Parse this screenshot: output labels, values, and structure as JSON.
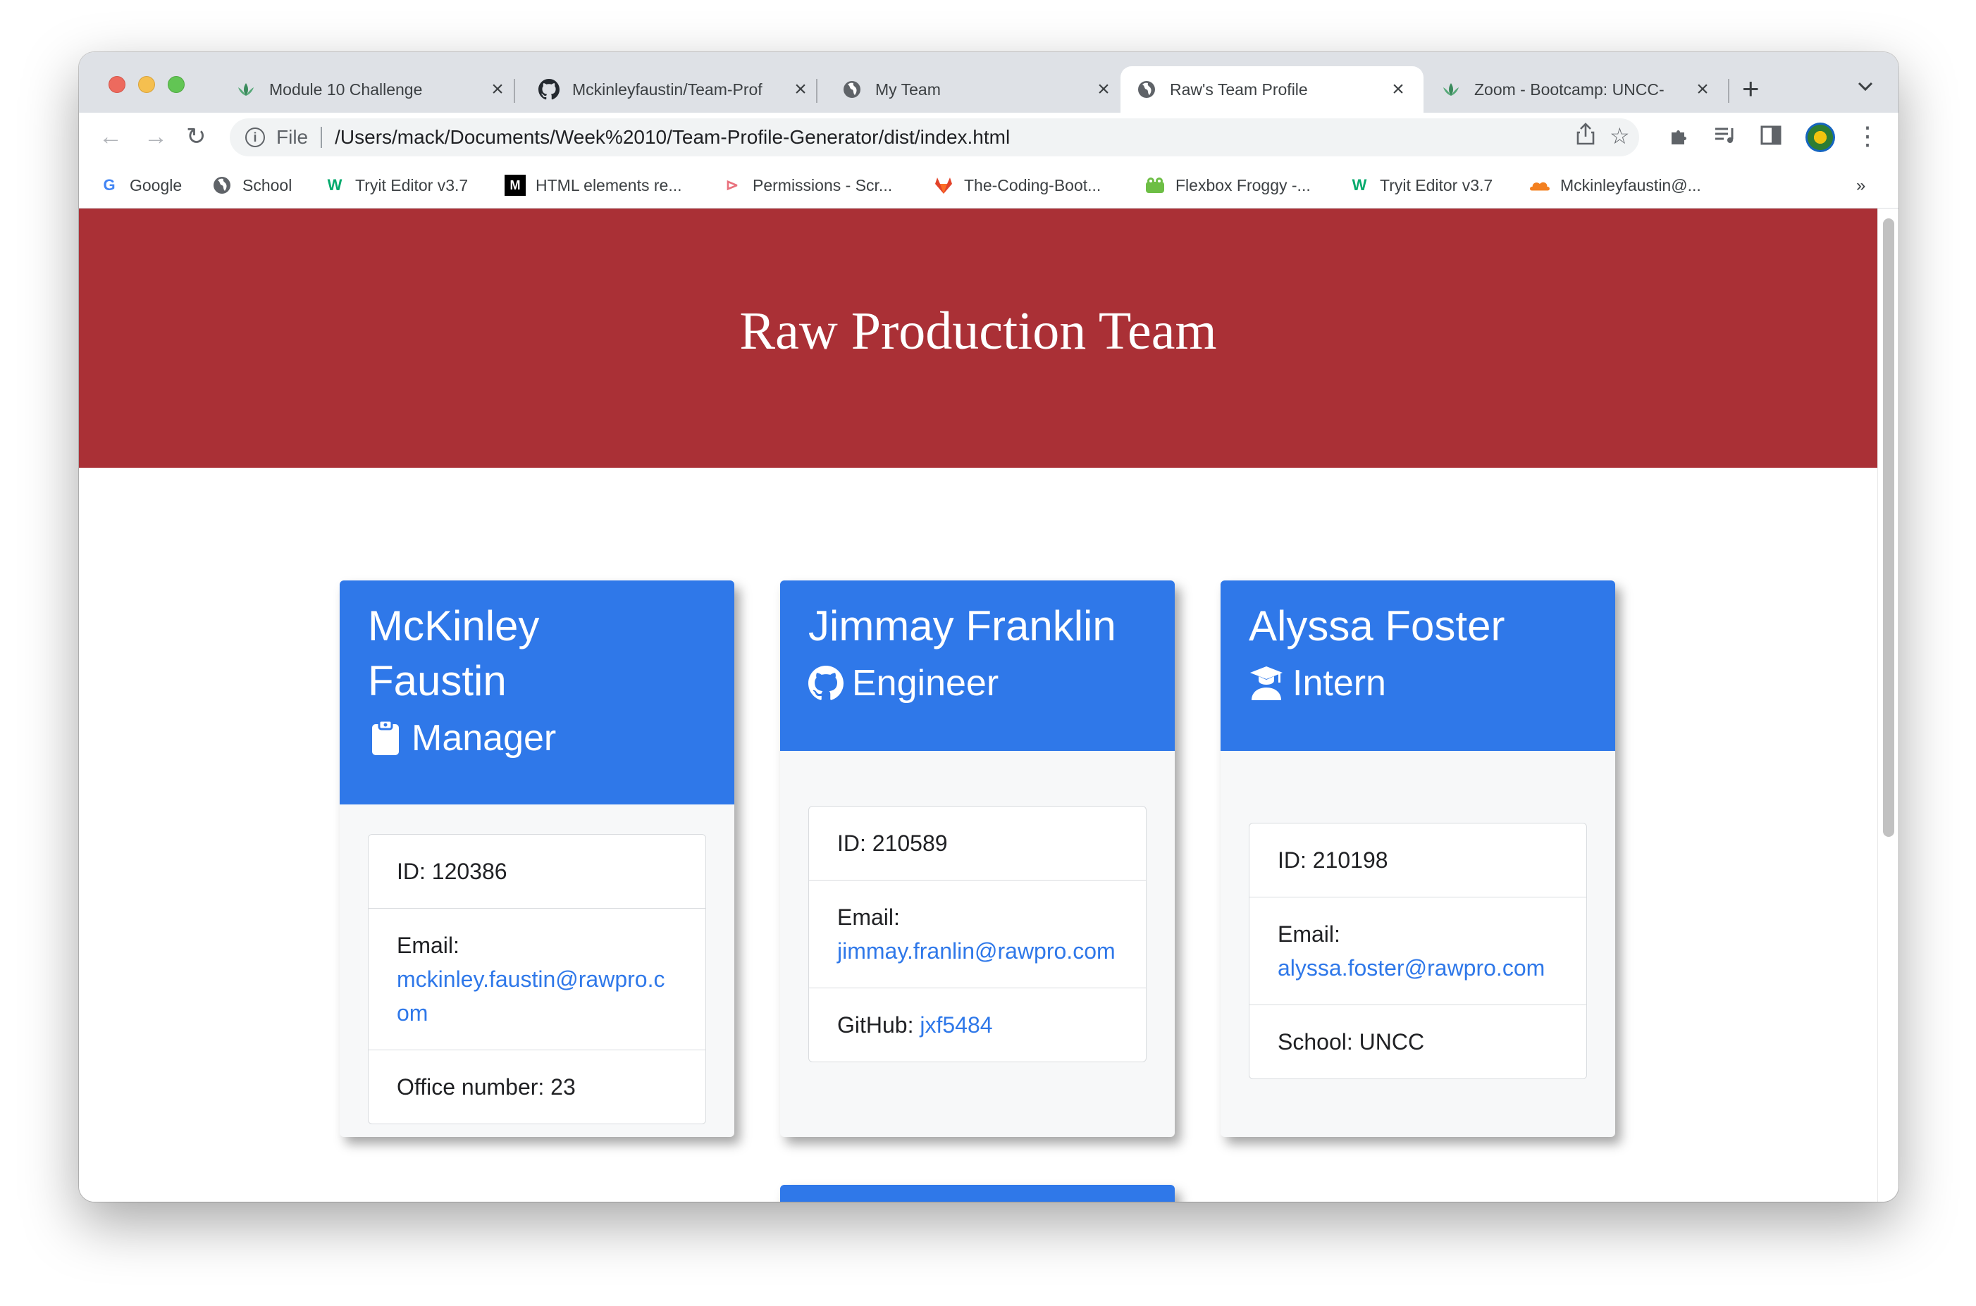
{
  "browser": {
    "tabs": [
      {
        "title": "Module 10 Challenge",
        "icon": "lotus-icon",
        "active": false
      },
      {
        "title": "Mckinleyfaustin/Team-Prof",
        "icon": "github-icon",
        "active": false
      },
      {
        "title": "My Team",
        "icon": "globe-icon",
        "active": false
      },
      {
        "title": "Raw's Team Profile",
        "icon": "globe-icon",
        "active": true
      },
      {
        "title": "Zoom - Bootcamp: UNCC-",
        "icon": "lotus-icon",
        "active": false
      }
    ],
    "new_tab_label": "+",
    "url_scheme": "File",
    "url": "/Users/mack/Documents/Week%2010/Team-Profile-Generator/dist/index.html",
    "bookmarks": [
      {
        "label": "Google",
        "icon": "google-icon"
      },
      {
        "label": "School",
        "icon": "globe-icon"
      },
      {
        "label": "Tryit Editor v3.7",
        "icon": "w3schools-icon"
      },
      {
        "label": "HTML elements re...",
        "icon": "mdn-icon"
      },
      {
        "label": "Permissions - Scr...",
        "icon": "scrimba-icon"
      },
      {
        "label": "The-Coding-Boot...",
        "icon": "gitlab-icon"
      },
      {
        "label": "Flexbox Froggy -...",
        "icon": "frog-icon"
      },
      {
        "label": "Tryit Editor v3.7",
        "icon": "w3schools-icon"
      },
      {
        "label": "Mckinleyfaustin@...",
        "icon": "cloud-icon"
      }
    ],
    "bookmarks_more": "»"
  },
  "page": {
    "title": "Raw Production Team",
    "colors": {
      "header": "#aa3036",
      "card_header": "#2f78e9",
      "link": "#2f78e9"
    },
    "cards": [
      {
        "name": "McKinley Faustin",
        "role": "Manager",
        "role_icon": "clipboard-icon",
        "id_text": "ID: 120386",
        "email_label": "Email:",
        "email": "mckinley.faustin@rawpro.com",
        "extra_label": "Office number: 23",
        "extra_link": ""
      },
      {
        "name": "Jimmay Franklin",
        "role": "Engineer",
        "role_icon": "github-icon",
        "id_text": "ID: 210589",
        "email_label": "Email:",
        "email": "jimmay.franlin@rawpro.com",
        "extra_label": "GitHub: ",
        "extra_link": "jxf5484"
      },
      {
        "name": "Alyssa Foster",
        "role": "Intern",
        "role_icon": "graduate-icon",
        "id_text": "ID: 210198",
        "email_label": "Email:",
        "email": "alyssa.foster@rawpro.com",
        "extra_label": "School: UNCC",
        "extra_link": ""
      }
    ]
  }
}
